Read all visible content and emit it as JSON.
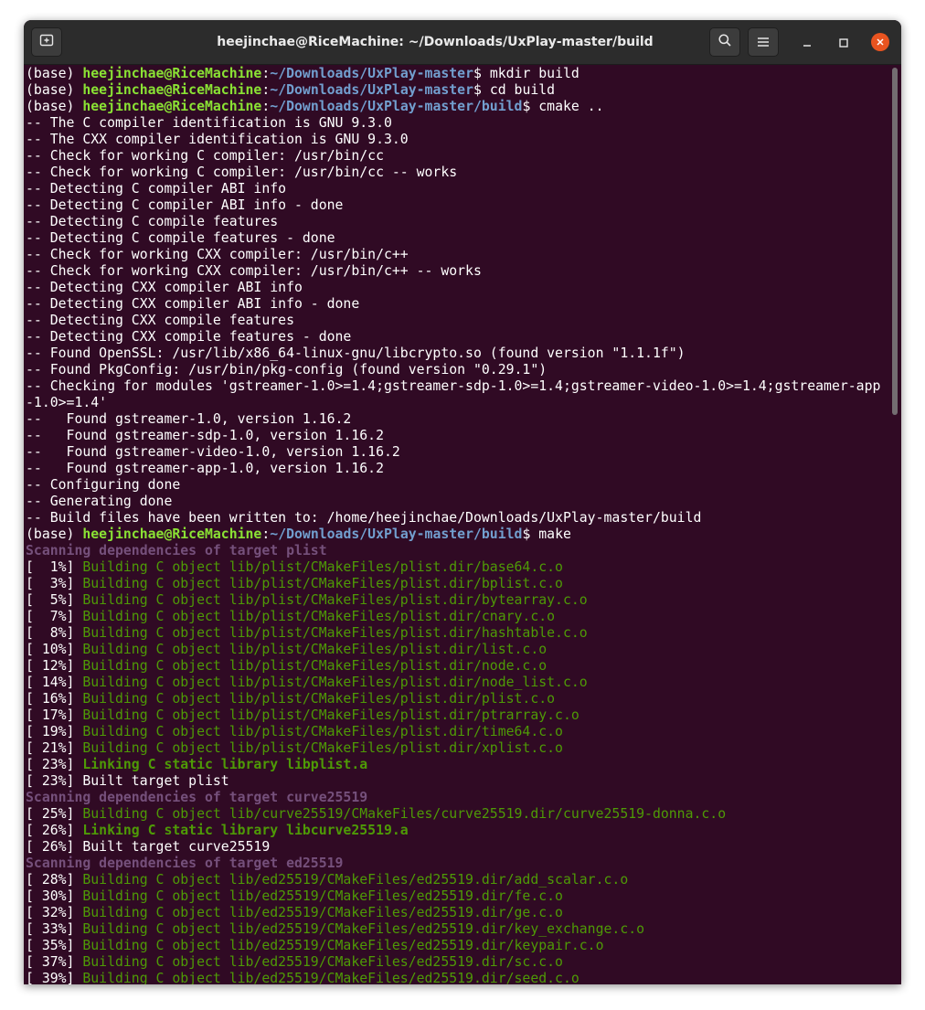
{
  "window": {
    "title": "heejinchae@RiceMachine: ~/Downloads/UxPlay-master/build",
    "icons": {
      "new_tab": "new-tab-icon",
      "search": "search-icon",
      "menu": "hamburger-menu-icon",
      "minimize": "minimize-icon",
      "maximize": "maximize-icon",
      "close": "close-icon"
    },
    "colors": {
      "background": "#300a24",
      "user": "#8ae234",
      "path": "#729fcf",
      "build_output": "#4e9a06",
      "scanning": "#75507b",
      "close_button": "#e95420"
    }
  },
  "terminal": {
    "lines": [
      {
        "type": "prompt",
        "env": "(base) ",
        "user": "heejinchae@RiceMachine",
        "sep": ":",
        "path": "~/Downloads/UxPlay-master",
        "cmd": "$ mkdir build"
      },
      {
        "type": "prompt",
        "env": "(base) ",
        "user": "heejinchae@RiceMachine",
        "sep": ":",
        "path": "~/Downloads/UxPlay-master",
        "cmd": "$ cd build"
      },
      {
        "type": "prompt",
        "env": "(base) ",
        "user": "heejinchae@RiceMachine",
        "sep": ":",
        "path": "~/Downloads/UxPlay-master/build",
        "cmd": "$ cmake .."
      },
      {
        "type": "text",
        "text": "-- The C compiler identification is GNU 9.3.0"
      },
      {
        "type": "text",
        "text": "-- The CXX compiler identification is GNU 9.3.0"
      },
      {
        "type": "text",
        "text": "-- Check for working C compiler: /usr/bin/cc"
      },
      {
        "type": "text",
        "text": "-- Check for working C compiler: /usr/bin/cc -- works"
      },
      {
        "type": "text",
        "text": "-- Detecting C compiler ABI info"
      },
      {
        "type": "text",
        "text": "-- Detecting C compiler ABI info - done"
      },
      {
        "type": "text",
        "text": "-- Detecting C compile features"
      },
      {
        "type": "text",
        "text": "-- Detecting C compile features - done"
      },
      {
        "type": "text",
        "text": "-- Check for working CXX compiler: /usr/bin/c++"
      },
      {
        "type": "text",
        "text": "-- Check for working CXX compiler: /usr/bin/c++ -- works"
      },
      {
        "type": "text",
        "text": "-- Detecting CXX compiler ABI info"
      },
      {
        "type": "text",
        "text": "-- Detecting CXX compiler ABI info - done"
      },
      {
        "type": "text",
        "text": "-- Detecting CXX compile features"
      },
      {
        "type": "text",
        "text": "-- Detecting CXX compile features - done"
      },
      {
        "type": "text",
        "text": "-- Found OpenSSL: /usr/lib/x86_64-linux-gnu/libcrypto.so (found version \"1.1.1f\")"
      },
      {
        "type": "text",
        "text": "-- Found PkgConfig: /usr/bin/pkg-config (found version \"0.29.1\")"
      },
      {
        "type": "text",
        "text": "-- Checking for modules 'gstreamer-1.0>=1.4;gstreamer-sdp-1.0>=1.4;gstreamer-video-1.0>=1.4;gstreamer-app"
      },
      {
        "type": "text",
        "text": "-1.0>=1.4'"
      },
      {
        "type": "text",
        "text": "--   Found gstreamer-1.0, version 1.16.2"
      },
      {
        "type": "text",
        "text": "--   Found gstreamer-sdp-1.0, version 1.16.2"
      },
      {
        "type": "text",
        "text": "--   Found gstreamer-video-1.0, version 1.16.2"
      },
      {
        "type": "text",
        "text": "--   Found gstreamer-app-1.0, version 1.16.2"
      },
      {
        "type": "text",
        "text": "-- Configuring done"
      },
      {
        "type": "text",
        "text": "-- Generating done"
      },
      {
        "type": "text",
        "text": "-- Build files have been written to: /home/heejinchae/Downloads/UxPlay-master/build"
      },
      {
        "type": "prompt",
        "env": "(base) ",
        "user": "heejinchae@RiceMachine",
        "sep": ":",
        "path": "~/Downloads/UxPlay-master/build",
        "cmd": "$ make"
      },
      {
        "type": "scan",
        "text": "Scanning dependencies of target plist"
      },
      {
        "type": "build",
        "pct": "[  1%] ",
        "text": "Building C object lib/plist/CMakeFiles/plist.dir/base64.c.o"
      },
      {
        "type": "build",
        "pct": "[  3%] ",
        "text": "Building C object lib/plist/CMakeFiles/plist.dir/bplist.c.o"
      },
      {
        "type": "build",
        "pct": "[  5%] ",
        "text": "Building C object lib/plist/CMakeFiles/plist.dir/bytearray.c.o"
      },
      {
        "type": "build",
        "pct": "[  7%] ",
        "text": "Building C object lib/plist/CMakeFiles/plist.dir/cnary.c.o"
      },
      {
        "type": "build",
        "pct": "[  8%] ",
        "text": "Building C object lib/plist/CMakeFiles/plist.dir/hashtable.c.o"
      },
      {
        "type": "build",
        "pct": "[ 10%] ",
        "text": "Building C object lib/plist/CMakeFiles/plist.dir/list.c.o"
      },
      {
        "type": "build",
        "pct": "[ 12%] ",
        "text": "Building C object lib/plist/CMakeFiles/plist.dir/node.c.o"
      },
      {
        "type": "build",
        "pct": "[ 14%] ",
        "text": "Building C object lib/plist/CMakeFiles/plist.dir/node_list.c.o"
      },
      {
        "type": "build",
        "pct": "[ 16%] ",
        "text": "Building C object lib/plist/CMakeFiles/plist.dir/plist.c.o"
      },
      {
        "type": "build",
        "pct": "[ 17%] ",
        "text": "Building C object lib/plist/CMakeFiles/plist.dir/ptrarray.c.o"
      },
      {
        "type": "build",
        "pct": "[ 19%] ",
        "text": "Building C object lib/plist/CMakeFiles/plist.dir/time64.c.o"
      },
      {
        "type": "build",
        "pct": "[ 21%] ",
        "text": "Building C object lib/plist/CMakeFiles/plist.dir/xplist.c.o"
      },
      {
        "type": "link",
        "pct": "[ 23%] ",
        "text": "Linking C static library libplist.a"
      },
      {
        "type": "built",
        "pct": "[ 23%] ",
        "text": "Built target plist"
      },
      {
        "type": "scan",
        "text": "Scanning dependencies of target curve25519"
      },
      {
        "type": "build",
        "pct": "[ 25%] ",
        "text": "Building C object lib/curve25519/CMakeFiles/curve25519.dir/curve25519-donna.c.o"
      },
      {
        "type": "link",
        "pct": "[ 26%] ",
        "text": "Linking C static library libcurve25519.a"
      },
      {
        "type": "built",
        "pct": "[ 26%] ",
        "text": "Built target curve25519"
      },
      {
        "type": "scan",
        "text": "Scanning dependencies of target ed25519"
      },
      {
        "type": "build",
        "pct": "[ 28%] ",
        "text": "Building C object lib/ed25519/CMakeFiles/ed25519.dir/add_scalar.c.o"
      },
      {
        "type": "build",
        "pct": "[ 30%] ",
        "text": "Building C object lib/ed25519/CMakeFiles/ed25519.dir/fe.c.o"
      },
      {
        "type": "build",
        "pct": "[ 32%] ",
        "text": "Building C object lib/ed25519/CMakeFiles/ed25519.dir/ge.c.o"
      },
      {
        "type": "build",
        "pct": "[ 33%] ",
        "text": "Building C object lib/ed25519/CMakeFiles/ed25519.dir/key_exchange.c.o"
      },
      {
        "type": "build",
        "pct": "[ 35%] ",
        "text": "Building C object lib/ed25519/CMakeFiles/ed25519.dir/keypair.c.o"
      },
      {
        "type": "build",
        "pct": "[ 37%] ",
        "text": "Building C object lib/ed25519/CMakeFiles/ed25519.dir/sc.c.o"
      },
      {
        "type": "build",
        "pct": "[ 39%] ",
        "text": "Building C object lib/ed25519/CMakeFiles/ed25519.dir/seed.c.o"
      }
    ]
  }
}
